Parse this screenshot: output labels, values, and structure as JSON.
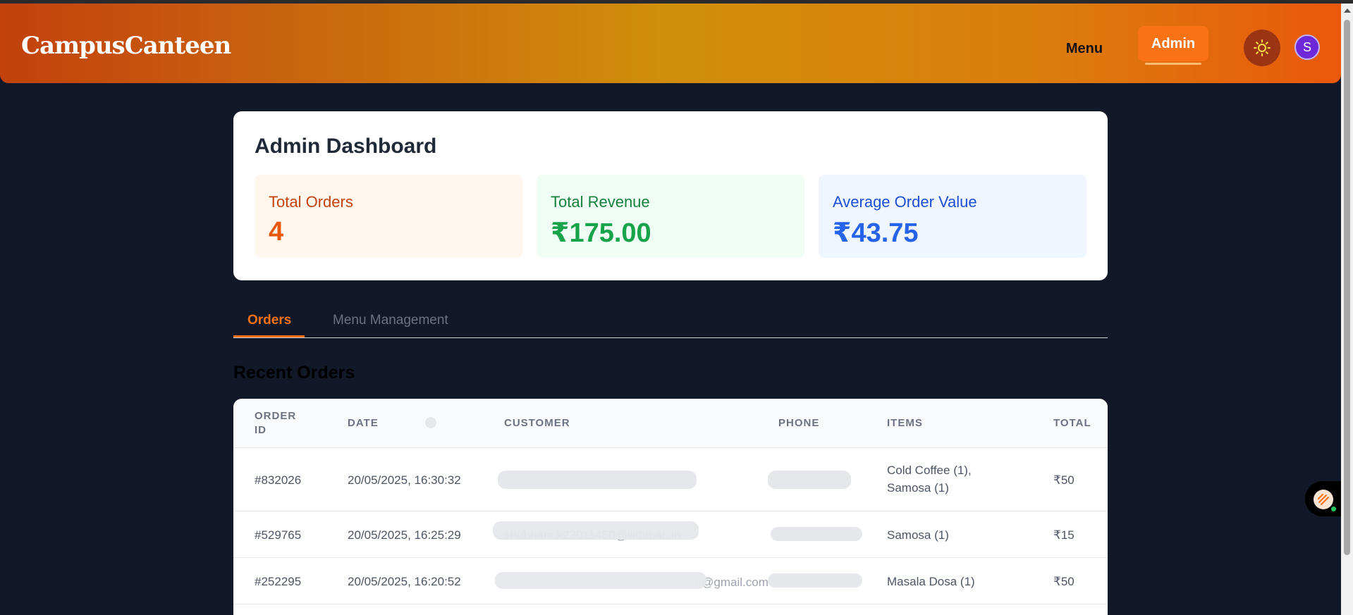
{
  "app": {
    "brand": "CampusCanteen"
  },
  "nav": {
    "menu_label": "Menu",
    "admin_label": "Admin",
    "avatar_initial": "S"
  },
  "dashboard": {
    "title": "Admin Dashboard",
    "stats": [
      {
        "label": "Total Orders",
        "value": "4"
      },
      {
        "label": "Total Revenue",
        "value": "₹175.00"
      },
      {
        "label": "Average Order Value",
        "value": "₹43.75"
      }
    ]
  },
  "tabs": [
    {
      "label": "Orders",
      "active": true
    },
    {
      "label": "Menu Management",
      "active": false
    }
  ],
  "recent_orders": {
    "title": "Recent Orders",
    "columns": [
      "ORDER",
      "ID",
      "DATE",
      "CUSTOMER",
      "PHONE",
      "ITEMS",
      "TOTAL"
    ],
    "rows": [
      {
        "id": "#832026",
        "date": "20/05/2025, 16:30:32",
        "items_line1": "Cold Coffee (1),",
        "items_line2": "Samosa (1)",
        "total": "₹50"
      },
      {
        "id": "#529765",
        "date": "20/05/2025, 16:25:29",
        "customer_visible": "shubham.k23011450@iiitbh.ac.in",
        "items_line1": "Samosa (1)",
        "total": "₹15"
      },
      {
        "id": "#252295",
        "date": "20/05/2025, 16:20:52",
        "customer_visible": "...@gmail.com",
        "items_line1": "Masala Dosa (1)",
        "total": "₹50"
      }
    ]
  },
  "colors": {
    "accent": "#f97316",
    "background": "#111827",
    "revenue": "#16a34a",
    "avg": "#2563eb"
  },
  "icons": {
    "theme": "sun-icon",
    "chat": "chat-widget-icon"
  }
}
